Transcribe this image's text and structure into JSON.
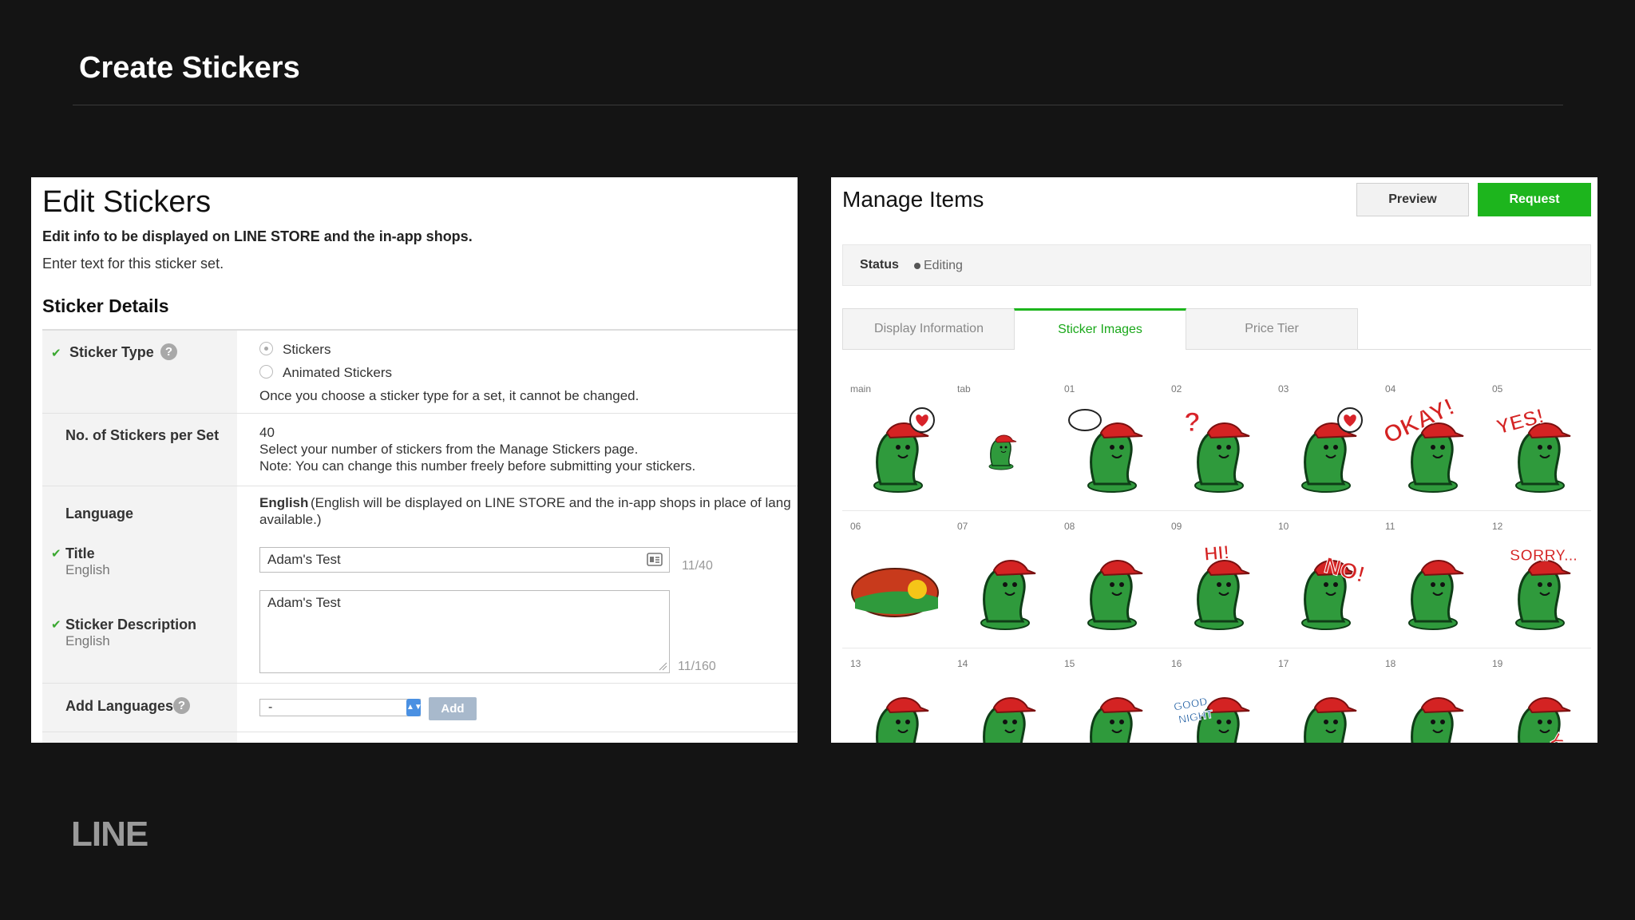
{
  "slide": {
    "title": "Create Stickers",
    "logo": "LINE"
  },
  "edit": {
    "title": "Edit Stickers",
    "subtitle": "Edit info to be displayed on LINE STORE and the in-app shops.",
    "enter_text": "Enter text for this sticker set.",
    "section_title": "Sticker Details",
    "sticker_type": {
      "label": "Sticker Type",
      "options": [
        "Stickers",
        "Animated Stickers"
      ],
      "selected": "Stickers",
      "note": "Once you choose a sticker type for a set, it cannot be changed."
    },
    "per_set": {
      "label": "No. of Stickers per Set",
      "value": "40",
      "line1": "Select your number of stickers from the Manage Stickers page.",
      "line2": "Note: You can change this number freely before submitting your stickers."
    },
    "language": {
      "label": "Language",
      "value": "English",
      "desc_line1": "(English will be displayed on LINE STORE and the in-app shops in place of lang",
      "desc_line2": "available.)"
    },
    "title_field": {
      "label": "Title",
      "sublabel": "English",
      "value": "Adam's Test",
      "counter": "11/40"
    },
    "description_field": {
      "label": "Sticker Description",
      "sublabel": "English",
      "value": "Adam's Test",
      "counter": "11/160"
    },
    "add_languages": {
      "label": "Add Languages",
      "select_value": "-",
      "button": "Add"
    }
  },
  "manage": {
    "title": "Manage Items",
    "preview_button": "Preview",
    "request_button": "Request",
    "status_label": "Status",
    "status_value": "Editing",
    "tabs": [
      {
        "label": "Display Information",
        "active": false
      },
      {
        "label": "Sticker Images",
        "active": true
      },
      {
        "label": "Price Tier",
        "active": false
      }
    ],
    "grid_labels": [
      [
        "main",
        "tab",
        "01",
        "02",
        "03",
        "04",
        "05"
      ],
      [
        "06",
        "07",
        "08",
        "09",
        "10",
        "11",
        "12"
      ],
      [
        "13",
        "14",
        "15",
        "16",
        "17",
        "18",
        "19"
      ]
    ],
    "sticker_texts": {
      "04": "OKAY!",
      "05": "YES!",
      "09": "HI!",
      "10": "NO!",
      "12": "SORRY...",
      "16a": "GOOD",
      "16b": "NIGHT",
      "19": "YEAH"
    }
  },
  "colors": {
    "accent_green": "#1db51d",
    "caterpillar_green": "#2f9a3c",
    "cap_red": "#d42323",
    "heart_red": "#d8232a"
  }
}
